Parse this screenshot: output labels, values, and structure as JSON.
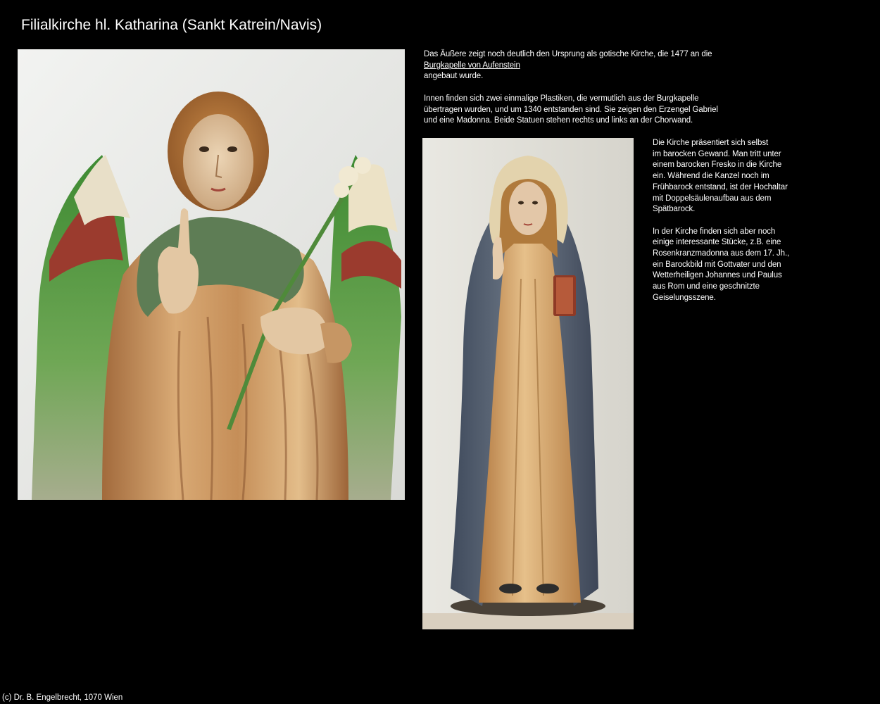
{
  "page": {
    "title": "Filialkirche hl. Katharina (Sankt Katrein/Navis)"
  },
  "intro": {
    "line1": "Das Äußere zeigt noch deutlich den Ursprung als gotische Kirche, die 1477 an die",
    "link": "Burgkapelle von Aufenstein",
    "line3": "angebaut wurde.",
    "para2": [
      "Innen finden sich zwei einmalige Plastiken, die vermutlich aus der Burgkapelle",
      "übertragen wurden, und um 1340 entstanden sind. Sie zeigen den Erzengel Gabriel",
      "und eine Madonna. Beide Statuen stehen rechts und links an der Chorwand."
    ]
  },
  "side": {
    "para1": [
      "Die Kirche präsentiert sich selbst",
      "im barocken Gewand. Man tritt unter",
      "einem barocken Fresko in die Kirche",
      "ein. Während die Kanzel noch im",
      "Frühbarock entstand, ist der Hochaltar",
      "mit Doppelsäulenaufbau aus dem",
      "Spätbarock."
    ],
    "para2": [
      "In der Kirche finden sich aber noch",
      "einige interessante Stücke, z.B. eine",
      "Rosenkranzmadonna aus dem 17. Jh.,",
      "ein Barockbild mit Gottvater und den",
      "Wetterheiligen Johannes und Paulus",
      "aus Rom und eine geschnitzte",
      "Geiselungsszene."
    ]
  },
  "footer": {
    "copyright": "(c) Dr. B. Engelbrecht, 1070 Wien"
  },
  "colors": {
    "background": "#000000",
    "text": "#ffffff"
  }
}
